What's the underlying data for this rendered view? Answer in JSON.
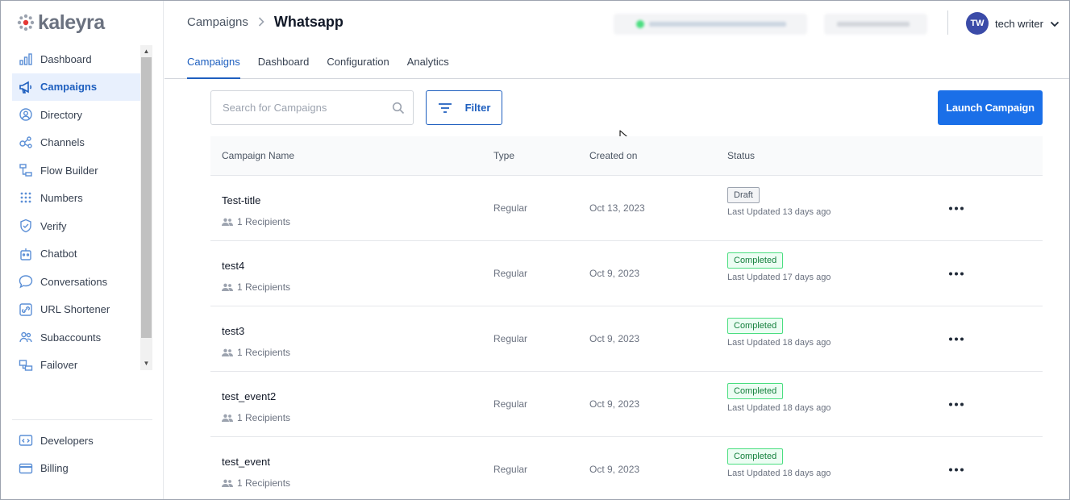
{
  "brand": {
    "name": "kaleyra"
  },
  "sidebar": {
    "items": [
      {
        "label": "Dashboard",
        "icon": "bar-chart-icon",
        "active": false
      },
      {
        "label": "Campaigns",
        "icon": "megaphone-icon",
        "active": true
      },
      {
        "label": "Directory",
        "icon": "contact-icon",
        "active": false
      },
      {
        "label": "Channels",
        "icon": "channels-icon",
        "active": false
      },
      {
        "label": "Flow Builder",
        "icon": "flow-icon",
        "active": false
      },
      {
        "label": "Numbers",
        "icon": "dialpad-icon",
        "active": false
      },
      {
        "label": "Verify",
        "icon": "shield-check-icon",
        "active": false
      },
      {
        "label": "Chatbot",
        "icon": "robot-icon",
        "active": false
      },
      {
        "label": "Conversations",
        "icon": "chat-bubble-icon",
        "active": false
      },
      {
        "label": "URL Shortener",
        "icon": "link-icon",
        "active": false
      },
      {
        "label": "Subaccounts",
        "icon": "users-icon",
        "active": false
      },
      {
        "label": "Failover",
        "icon": "failover-icon",
        "active": false
      }
    ],
    "bottom_items": [
      {
        "label": "Developers",
        "icon": "code-icon"
      },
      {
        "label": "Billing",
        "icon": "card-icon"
      }
    ]
  },
  "header": {
    "breadcrumb_parent": "Campaigns",
    "breadcrumb_current": "Whatsapp",
    "user": {
      "initials": "TW",
      "name": "tech writer"
    },
    "tabs": [
      {
        "label": "Campaigns",
        "active": true
      },
      {
        "label": "Dashboard",
        "active": false
      },
      {
        "label": "Configuration",
        "active": false
      },
      {
        "label": "Analytics",
        "active": false
      }
    ]
  },
  "toolbar": {
    "search_placeholder": "Search for Campaigns",
    "filter_label": "Filter",
    "launch_label": "Launch Campaign"
  },
  "table": {
    "columns": [
      "Campaign Name",
      "Type",
      "Created on",
      "Status"
    ],
    "rows": [
      {
        "name": "Test-title",
        "recipients": "1 Recipients",
        "type": "Regular",
        "created": "Oct 13, 2023",
        "status": "Draft",
        "updated": "Last Updated 13 days ago"
      },
      {
        "name": "test4",
        "recipients": "1 Recipients",
        "type": "Regular",
        "created": "Oct 9, 2023",
        "status": "Completed",
        "updated": "Last Updated 17 days ago"
      },
      {
        "name": "test3",
        "recipients": "1 Recipients",
        "type": "Regular",
        "created": "Oct 9, 2023",
        "status": "Completed",
        "updated": "Last Updated 18 days ago"
      },
      {
        "name": "test_event2",
        "recipients": "1 Recipients",
        "type": "Regular",
        "created": "Oct 9, 2023",
        "status": "Completed",
        "updated": "Last Updated 18 days ago"
      },
      {
        "name": "test_event",
        "recipients": "1 Recipients",
        "type": "Regular",
        "created": "Oct 9, 2023",
        "status": "Completed",
        "updated": "Last Updated 18 days ago"
      }
    ]
  },
  "colors": {
    "accent": "#1a6fe8",
    "active_bg": "#e8f0fd",
    "completed": "#15803d",
    "avatar": "#3b4ba8"
  }
}
